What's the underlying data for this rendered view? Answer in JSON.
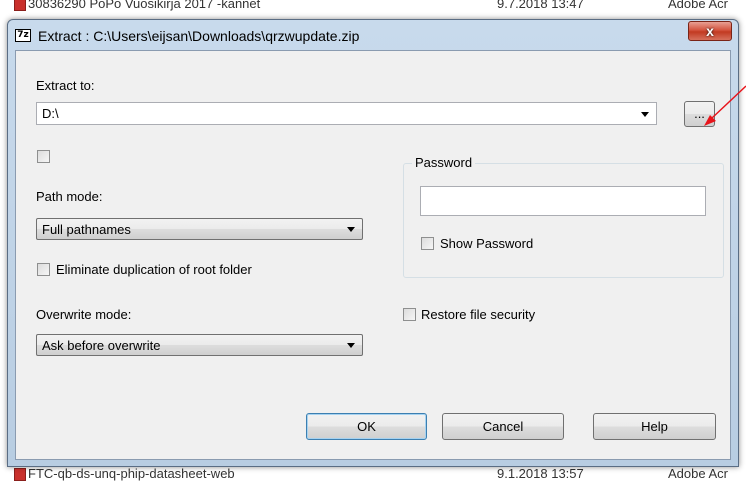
{
  "background": {
    "top_row": {
      "name": "30836290 PoPo Vuosikirja 2017 -kannet",
      "date": "9.7.2018 13:47",
      "type": "Adobe Acr"
    },
    "bottom_row": {
      "name": "FTC-qb-ds-unq-phip-datasheet-web",
      "date": "9.1.2018 13:57",
      "type": "Adobe Acr"
    }
  },
  "window": {
    "app_icon_text": "7z",
    "title": "Extract : C:\\Users\\eijsan\\Downloads\\qrzwupdate.zip",
    "close_label": "x"
  },
  "extract_to": {
    "label": "Extract to:",
    "value": "D:\\",
    "browse_label": "..."
  },
  "path_mode": {
    "label": "Path mode:",
    "value": "Full pathnames"
  },
  "eliminate_duplication_label": "Eliminate duplication of root folder",
  "overwrite_mode": {
    "label": "Overwrite mode:",
    "value": "Ask before overwrite"
  },
  "password": {
    "group_label": "Password",
    "value": "",
    "show_password_label": "Show Password"
  },
  "restore_security_label": "Restore file security",
  "buttons": {
    "ok": "OK",
    "cancel": "Cancel",
    "help": "Help"
  },
  "colors": {
    "annotation_arrow": "#e8141b",
    "title_bar": "#c8daec",
    "close_button": "#c23a22"
  }
}
